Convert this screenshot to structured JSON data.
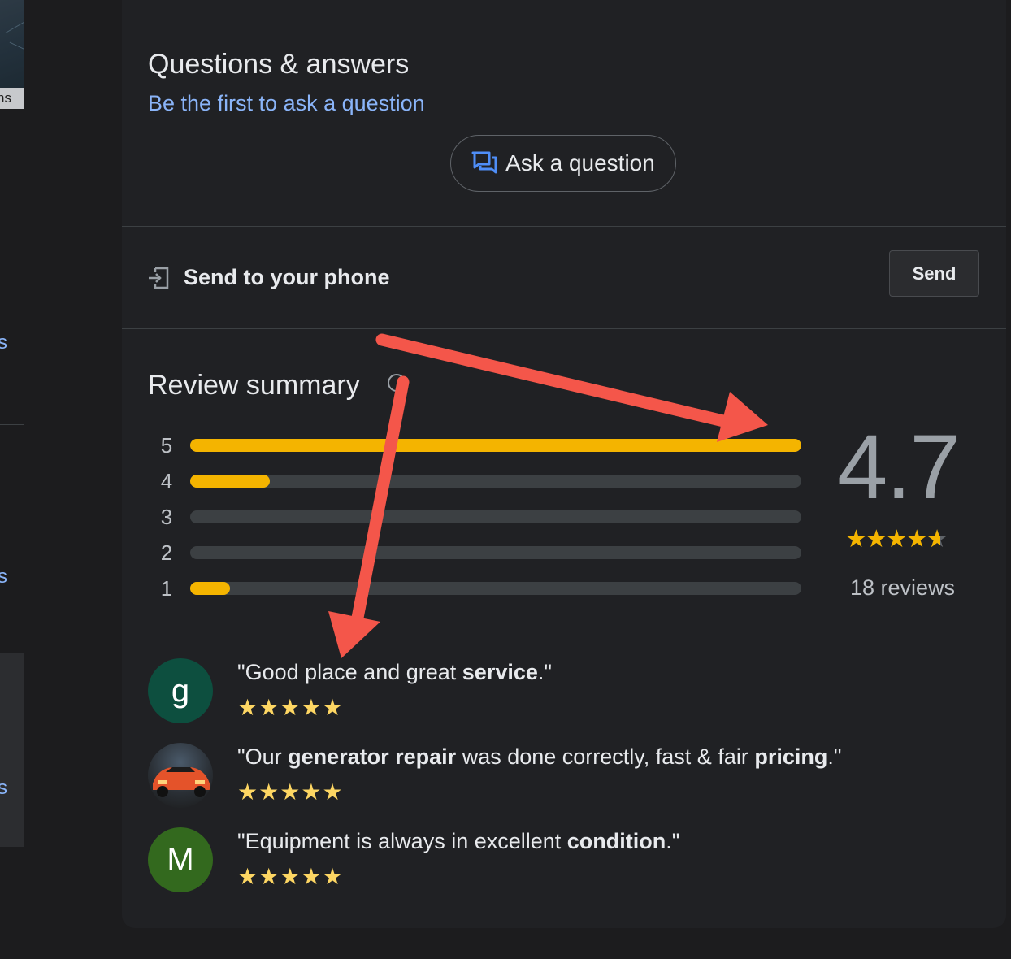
{
  "left_strip": {
    "map_label": "ns",
    "link_fragments": [
      "s",
      "s",
      "s"
    ]
  },
  "qa": {
    "title": "Questions & answers",
    "first_link": "Be the first to ask a question",
    "ask_button_label": "Ask a question",
    "ask_button_icon": "forum-icon"
  },
  "send_to_phone": {
    "label": "Send to your phone",
    "icon": "send-to-device-icon",
    "button_label": "Send"
  },
  "review_summary": {
    "title": "Review summary",
    "info_icon": "info-icon",
    "rating": "4.7",
    "rating_value": 4.7,
    "review_count": "18 reviews",
    "bars": [
      {
        "label": "5",
        "fraction": 1.0
      },
      {
        "label": "4",
        "fraction": 0.13
      },
      {
        "label": "3",
        "fraction": 0.0
      },
      {
        "label": "2",
        "fraction": 0.0
      },
      {
        "label": "1",
        "fraction": 0.065
      }
    ],
    "colors": {
      "fill": "#f4b400",
      "track": "#3c4043",
      "arrow": "#f4564a"
    }
  },
  "reviews": [
    {
      "avatar_letter": "g",
      "avatar_color": "#0d4f3f",
      "quote_parts": [
        {
          "text": "\"Good place and great ",
          "bold": false
        },
        {
          "text": "service",
          "bold": true
        },
        {
          "text": ".\"",
          "bold": false
        }
      ],
      "stars": 5
    },
    {
      "avatar_letter": "",
      "avatar_image": "orange-sports-car",
      "quote_parts": [
        {
          "text": "\"Our ",
          "bold": false
        },
        {
          "text": "generator repair",
          "bold": true
        },
        {
          "text": " was done correctly, fast & fair ",
          "bold": false
        },
        {
          "text": "pricing",
          "bold": true
        },
        {
          "text": ".\"",
          "bold": false
        }
      ],
      "stars": 5
    },
    {
      "avatar_letter": "M",
      "avatar_color": "#33691e",
      "quote_parts": [
        {
          "text": "\"Equipment is always in excellent ",
          "bold": false
        },
        {
          "text": "condition",
          "bold": true
        },
        {
          "text": ".\"",
          "bold": false
        }
      ],
      "stars": 5
    }
  ]
}
